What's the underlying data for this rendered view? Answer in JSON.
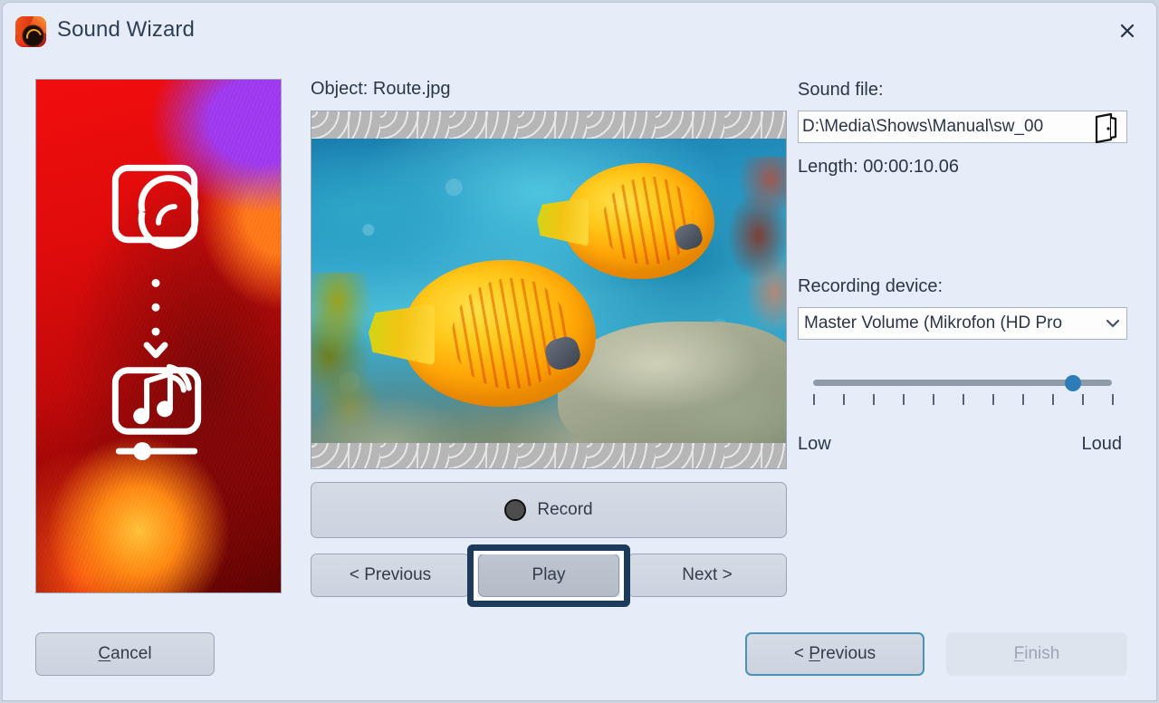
{
  "window": {
    "title": "Sound Wizard",
    "app_icon": "sound-wizard-icon",
    "close_icon": "close-icon",
    "background_color": "#e6edf8",
    "title_color": "#2e3f55"
  },
  "left_preview": {
    "name": "slide-transition-preview",
    "icons": [
      "slide-image-icon",
      "dotted-down-arrow-icon",
      "sound-on-slide-icon"
    ],
    "image_description": "red and orange canyon rock"
  },
  "center": {
    "object_label": "Object: Route.jpg",
    "preview": {
      "name": "object-preview",
      "image_description": "two yellow butterflyfish over a blue coral reef",
      "letterbox_color": "#b6b6b6"
    },
    "record_button": {
      "label": "Record",
      "icon": "record-dot-icon"
    },
    "nav": {
      "previous": "< Previous",
      "play": "Play",
      "next": "Next >"
    },
    "focus_highlight_color": "#1b3a5c"
  },
  "right": {
    "sound_file_label": "Sound file:",
    "sound_file_value": "D:\\Media\\Shows\\Manual\\sw_00",
    "browse_icon": "open-folder-icon",
    "length_label": "Length: 00:00:10.06",
    "recording_device_label": "Recording device:",
    "recording_device_value": "Master Volume (Mikrofon (HD Pro",
    "dropdown_icon": "chevron-down-icon",
    "volume": {
      "percent": 87,
      "tick_count": 11,
      "min_label": "Low",
      "max_label": "Loud",
      "thumb_color": "#2b7cb8",
      "track_color": "#8f9aa9"
    }
  },
  "footer": {
    "cancel": "Cancel",
    "cancel_accel": "C",
    "previous": "< Previous",
    "previous_accel": "P",
    "finish": "Finish",
    "finish_accel": "F",
    "finish_enabled": false,
    "default_button_border": "#4b92b8"
  }
}
